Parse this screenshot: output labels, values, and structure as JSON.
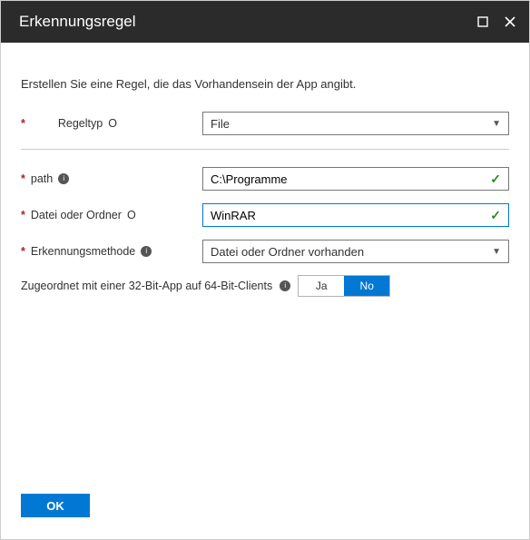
{
  "title": "Erkennungsregel",
  "intro": "Erstellen Sie eine Regel, die das Vorhandensein der App angibt.",
  "labels": {
    "regeltyp": "Regeltyp",
    "path": "path",
    "dateiOderOrdner": "Datei oder Ordner",
    "erkennungsmethode": "Erkennungsmethode",
    "zugeordnet": "Zugeordnet mit einer 32-Bit-App auf 64-Bit-Clients"
  },
  "values": {
    "regeltyp": "File",
    "path": "C:\\Programme",
    "dateiOderOrdner": "WinRAR",
    "erkennungsmethode": "Datei oder Ordner vorhanden"
  },
  "toggle": {
    "yes": "Ja",
    "no": "No",
    "selected": "no"
  },
  "buttons": {
    "ok": "OK"
  },
  "glyphs": {
    "infoHelp": "O"
  }
}
